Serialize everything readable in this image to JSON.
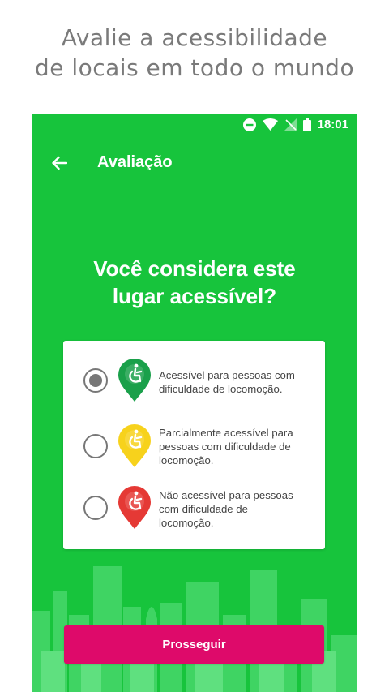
{
  "promo": {
    "line1": "Avalie a acessibilidade",
    "line2": "de locais em todo o mundo"
  },
  "status": {
    "time": "18:01"
  },
  "appbar": {
    "title": "Avaliação",
    "back_icon": "arrow-left-icon"
  },
  "question": {
    "line1": "Você considera este",
    "line2": "lugar acessível?"
  },
  "options": [
    {
      "lines": [
        "Acessível para pessoas com",
        "dificuldade de locomoção."
      ],
      "color": "#1aa04a",
      "selected": true
    },
    {
      "lines": [
        "Parcialmente acessível para",
        "pessoas com dificuldade de",
        "locomoção."
      ],
      "color": "#f7d21c",
      "selected": false
    },
    {
      "lines": [
        "Não acessível para pessoas",
        "com dificuldade de",
        "locomoção."
      ],
      "color": "#e53935",
      "selected": false
    }
  ],
  "cta": {
    "label": "Prosseguir"
  },
  "colors": {
    "background": "#17c43c",
    "button": "#de0a6a",
    "radio": "#777777"
  }
}
